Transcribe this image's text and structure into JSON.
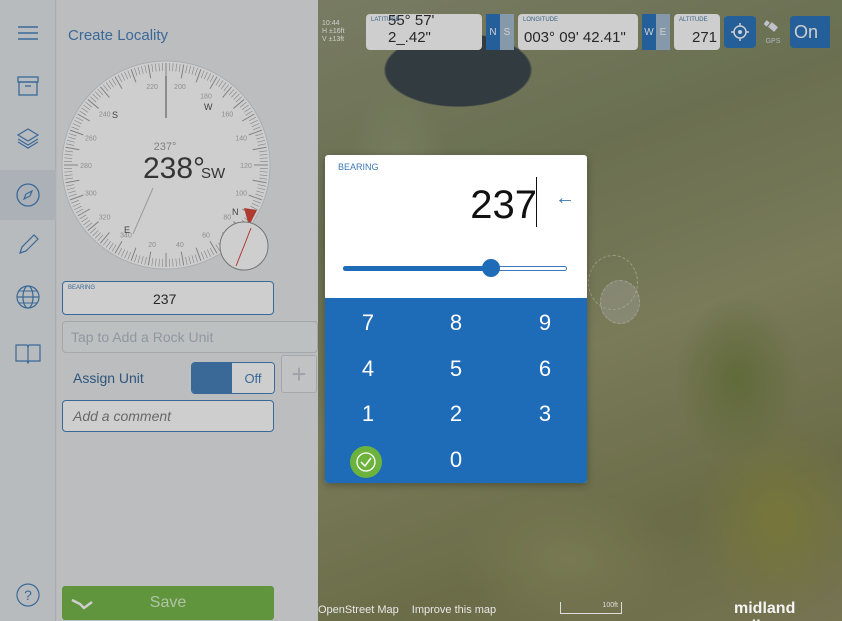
{
  "app": {
    "panel_title": "Create Locality"
  },
  "rail": {
    "items": [
      {
        "name": "menu",
        "icon": "hamburger-menu-icon"
      },
      {
        "name": "archive",
        "icon": "archive-box-icon"
      },
      {
        "name": "layers",
        "icon": "layers-icon"
      },
      {
        "name": "compass",
        "icon": "compass-icon"
      },
      {
        "name": "pencil",
        "icon": "pencil-icon"
      },
      {
        "name": "globe",
        "icon": "globe-icon"
      },
      {
        "name": "notebook",
        "icon": "book-icon"
      },
      {
        "name": "help",
        "icon": "help-icon"
      }
    ]
  },
  "gps": {
    "time": "10:44",
    "h_accuracy": "H  ±16ft",
    "v_accuracy": "V  ±13ft",
    "latitude_label": "LATITUDE",
    "latitude": "55° 57' 2_.42\"",
    "lat_n": "N",
    "lat_s": "S",
    "longitude_label": "LONGITUDE",
    "longitude": "003° 09' 42.41\"",
    "lon_w": "W",
    "lon_e": "E",
    "altitude_label": "ALTITUDE",
    "altitude": "271",
    "gps_label": "GPS",
    "gps_toggle": "On"
  },
  "compass": {
    "small_reading": "237°",
    "main_reading": "238°",
    "direction": "SW",
    "cardinals": [
      "N",
      "S",
      "E",
      "W"
    ],
    "ring_numbers": [
      "220",
      "200",
      "180",
      "160",
      "140",
      "120",
      "100",
      "80",
      "60",
      "40",
      "20",
      "340",
      "320",
      "300",
      "280",
      "260",
      "240"
    ]
  },
  "form": {
    "bearing_label": "BEARING",
    "bearing_value": "237",
    "rock_unit_placeholder": "Tap to Add a Rock Unit",
    "assign_unit_label": "Assign Unit",
    "assign_unit_state": "Off",
    "plus_label": "+",
    "comment_placeholder": "Add a comment",
    "save_label": "Save"
  },
  "dialog": {
    "label": "BEARING",
    "value": "237",
    "backspace": "←",
    "slider_fraction": 0.66,
    "keys": [
      "7",
      "8",
      "9",
      "4",
      "5",
      "6",
      "1",
      "2",
      "3",
      "0"
    ]
  },
  "map": {
    "attribution": "OpenStreet Map",
    "improve": "Improve this map",
    "scale": "100ft",
    "brand": "midland valley"
  },
  "colors": {
    "accent": "#1e6bb8",
    "save": "#6cb33e",
    "title": "#3a78b7"
  }
}
